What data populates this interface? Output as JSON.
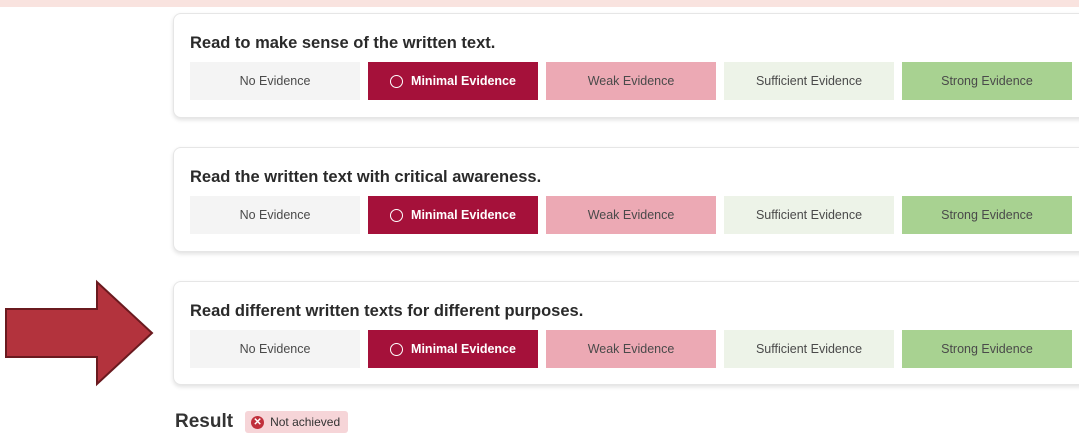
{
  "options": [
    {
      "label": "No Evidence"
    },
    {
      "label": "Minimal Evidence"
    },
    {
      "label": "Weak Evidence"
    },
    {
      "label": "Sufficient Evidence"
    },
    {
      "label": "Strong Evidence"
    }
  ],
  "option_colors": [
    "#f4f4f4",
    "#a5113a",
    "#eca9b4",
    "#edf3e8",
    "#a8d291"
  ],
  "selected_index": 1,
  "criteria": [
    {
      "title": "Read to make sense of the written text."
    },
    {
      "title": "Read the written text with critical awareness."
    },
    {
      "title": "Read different written texts for different purposes."
    }
  ],
  "arrow_color": "#b3333d",
  "result": {
    "label": "Result",
    "status": "Not achieved",
    "status_icon": "x-circle-icon"
  }
}
